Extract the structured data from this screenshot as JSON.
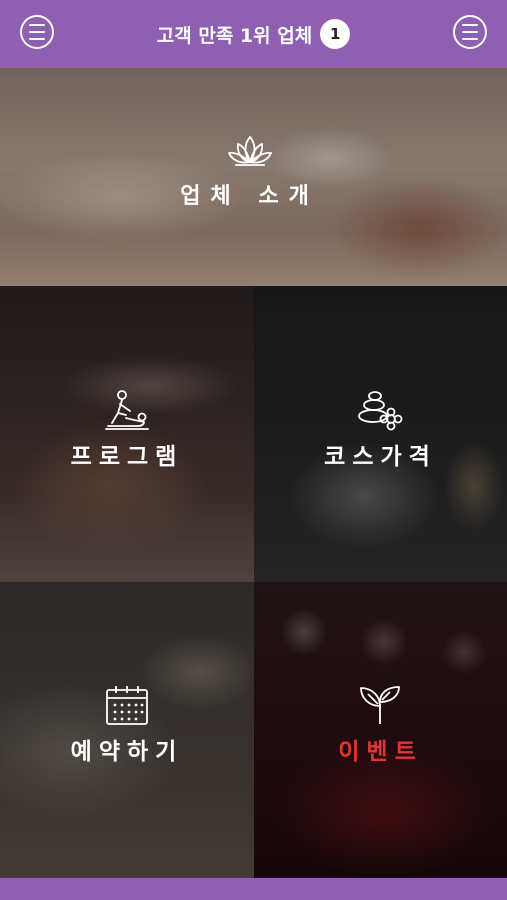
{
  "header": {
    "title": "고객 만족 1위 업체",
    "badge": "1",
    "left_menu_icon": "menu-icon",
    "right_menu_icon": "menu-icon",
    "bar_color": "#8e5fb3"
  },
  "tiles": [
    {
      "id": "intro",
      "label": "업체 소개",
      "icon": "lotus-icon"
    },
    {
      "id": "program",
      "label": "프로그램",
      "icon": "massage-icon"
    },
    {
      "id": "price",
      "label": "코스가격",
      "icon": "spa-stones-icon"
    },
    {
      "id": "reserve",
      "label": "예약하기",
      "icon": "calendar-icon"
    },
    {
      "id": "event",
      "label": "이벤트",
      "icon": "sprout-icon",
      "label_color": "#e53333"
    }
  ]
}
